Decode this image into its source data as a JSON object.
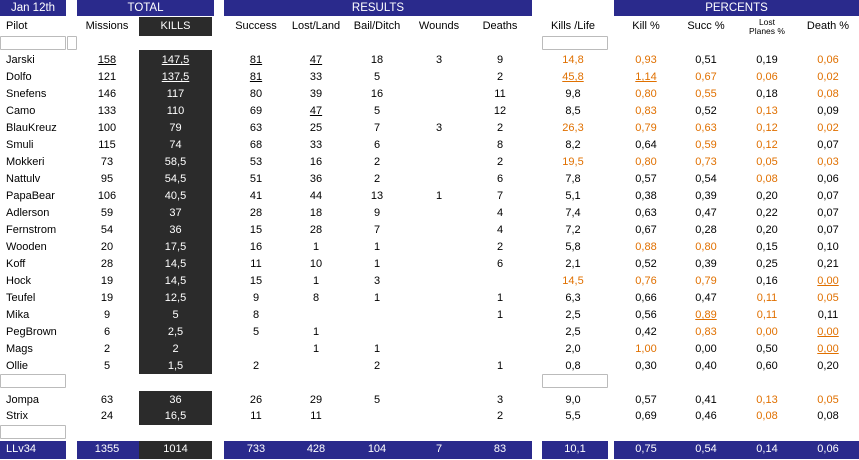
{
  "header": {
    "date": "Jan 12th",
    "total": "TOTAL",
    "results": "RESULTS",
    "percents": "PERCENTS"
  },
  "columns": {
    "pilot": "Pilot",
    "missions": "Missions",
    "kills": "KILLS",
    "success": "Success",
    "lostland": "Lost/Land",
    "bail": "Bail/Ditch",
    "wounds": "Wounds",
    "deaths": "Deaths",
    "kpl": "Kills /Life",
    "killpct": "Kill %",
    "succpct": "Succ %",
    "lostpct_line1": "Lost",
    "lostpct_line2": "Planes %",
    "deathpct": "Death %"
  },
  "rows": [
    {
      "pilot": "Jarski",
      "missions": "158",
      "kills": "147,5",
      "success": "81",
      "lostland": "47",
      "bail": "18",
      "wounds": "3",
      "deaths": "9",
      "kpl": "14,8",
      "killpct": "0,93",
      "succpct": "0,51",
      "lostpct": "0,19",
      "deathpct": "0,06"
    },
    {
      "pilot": "Dolfo",
      "missions": "121",
      "kills": "137,5",
      "success": "81",
      "lostland": "33",
      "bail": "5",
      "wounds": "",
      "deaths": "2",
      "kpl": "45,8",
      "killpct": "1,14",
      "succpct": "0,67",
      "lostpct": "0,06",
      "deathpct": "0,02"
    },
    {
      "pilot": "Snefens",
      "missions": "146",
      "kills": "117",
      "success": "80",
      "lostland": "39",
      "bail": "16",
      "wounds": "",
      "deaths": "11",
      "kpl": "9,8",
      "killpct": "0,80",
      "succpct": "0,55",
      "lostpct": "0,18",
      "deathpct": "0,08"
    },
    {
      "pilot": "Camo",
      "missions": "133",
      "kills": "110",
      "success": "69",
      "lostland": "47",
      "bail": "5",
      "wounds": "",
      "deaths": "12",
      "kpl": "8,5",
      "killpct": "0,83",
      "succpct": "0,52",
      "lostpct": "0,13",
      "deathpct": "0,09"
    },
    {
      "pilot": "BlauKreuz",
      "missions": "100",
      "kills": "79",
      "success": "63",
      "lostland": "25",
      "bail": "7",
      "wounds": "3",
      "deaths": "2",
      "kpl": "26,3",
      "killpct": "0,79",
      "succpct": "0,63",
      "lostpct": "0,12",
      "deathpct": "0,02"
    },
    {
      "pilot": "Smuli",
      "missions": "115",
      "kills": "74",
      "success": "68",
      "lostland": "33",
      "bail": "6",
      "wounds": "",
      "deaths": "8",
      "kpl": "8,2",
      "killpct": "0,64",
      "succpct": "0,59",
      "lostpct": "0,12",
      "deathpct": "0,07"
    },
    {
      "pilot": "Mokkeri",
      "missions": "73",
      "kills": "58,5",
      "success": "53",
      "lostland": "16",
      "bail": "2",
      "wounds": "",
      "deaths": "2",
      "kpl": "19,5",
      "killpct": "0,80",
      "succpct": "0,73",
      "lostpct": "0,05",
      "deathpct": "0,03"
    },
    {
      "pilot": "Nattulv",
      "missions": "95",
      "kills": "54,5",
      "success": "51",
      "lostland": "36",
      "bail": "2",
      "wounds": "",
      "deaths": "6",
      "kpl": "7,8",
      "killpct": "0,57",
      "succpct": "0,54",
      "lostpct": "0,08",
      "deathpct": "0,06"
    },
    {
      "pilot": "PapaBear",
      "missions": "106",
      "kills": "40,5",
      "success": "41",
      "lostland": "44",
      "bail": "13",
      "wounds": "1",
      "deaths": "7",
      "kpl": "5,1",
      "killpct": "0,38",
      "succpct": "0,39",
      "lostpct": "0,20",
      "deathpct": "0,07"
    },
    {
      "pilot": "Adlerson",
      "missions": "59",
      "kills": "37",
      "success": "28",
      "lostland": "18",
      "bail": "9",
      "wounds": "",
      "deaths": "4",
      "kpl": "7,4",
      "killpct": "0,63",
      "succpct": "0,47",
      "lostpct": "0,22",
      "deathpct": "0,07"
    },
    {
      "pilot": "Fernstrom",
      "missions": "54",
      "kills": "36",
      "success": "15",
      "lostland": "28",
      "bail": "7",
      "wounds": "",
      "deaths": "4",
      "kpl": "7,2",
      "killpct": "0,67",
      "succpct": "0,28",
      "lostpct": "0,20",
      "deathpct": "0,07"
    },
    {
      "pilot": "Wooden",
      "missions": "20",
      "kills": "17,5",
      "success": "16",
      "lostland": "1",
      "bail": "1",
      "wounds": "",
      "deaths": "2",
      "kpl": "5,8",
      "killpct": "0,88",
      "succpct": "0,80",
      "lostpct": "0,15",
      "deathpct": "0,10"
    },
    {
      "pilot": "Koff",
      "missions": "28",
      "kills": "14,5",
      "success": "11",
      "lostland": "10",
      "bail": "1",
      "wounds": "",
      "deaths": "6",
      "kpl": "2,1",
      "killpct": "0,52",
      "succpct": "0,39",
      "lostpct": "0,25",
      "deathpct": "0,21"
    },
    {
      "pilot": "Hock",
      "missions": "19",
      "kills": "14,5",
      "success": "15",
      "lostland": "1",
      "bail": "3",
      "wounds": "",
      "deaths": "",
      "kpl": "14,5",
      "killpct": "0,76",
      "succpct": "0,79",
      "lostpct": "0,16",
      "deathpct": "0,00"
    },
    {
      "pilot": "Teufel",
      "missions": "19",
      "kills": "12,5",
      "success": "9",
      "lostland": "8",
      "bail": "1",
      "wounds": "",
      "deaths": "1",
      "kpl": "6,3",
      "killpct": "0,66",
      "succpct": "0,47",
      "lostpct": "0,11",
      "deathpct": "0,05"
    },
    {
      "pilot": "Mika",
      "missions": "9",
      "kills": "5",
      "success": "8",
      "lostland": "",
      "bail": "",
      "wounds": "",
      "deaths": "1",
      "kpl": "2,5",
      "killpct": "0,56",
      "succpct": "0,89",
      "lostpct": "0,11",
      "deathpct": "0,11"
    },
    {
      "pilot": "PegBrown",
      "missions": "6",
      "kills": "2,5",
      "success": "5",
      "lostland": "1",
      "bail": "",
      "wounds": "",
      "deaths": "",
      "kpl": "2,5",
      "killpct": "0,42",
      "succpct": "0,83",
      "lostpct": "0,00",
      "deathpct": "0,00"
    },
    {
      "pilot": "Mags",
      "missions": "2",
      "kills": "2",
      "success": "",
      "lostland": "1",
      "bail": "1",
      "wounds": "",
      "deaths": "",
      "kpl": "2,0",
      "killpct": "1,00",
      "succpct": "0,00",
      "lostpct": "0,50",
      "deathpct": "0,00"
    },
    {
      "pilot": "Ollie",
      "missions": "5",
      "kills": "1,5",
      "success": "2",
      "lostland": "",
      "bail": "2",
      "wounds": "",
      "deaths": "1",
      "kpl": "0,8",
      "killpct": "0,30",
      "succpct": "0,40",
      "lostpct": "0,60",
      "deathpct": "0,20"
    },
    {
      "pilot": "Jompa",
      "missions": "63",
      "kills": "36",
      "success": "26",
      "lostland": "29",
      "bail": "5",
      "wounds": "",
      "deaths": "3",
      "kpl": "9,0",
      "killpct": "0,57",
      "succpct": "0,41",
      "lostpct": "0,13",
      "deathpct": "0,05"
    },
    {
      "pilot": "Strix",
      "missions": "24",
      "kills": "16,5",
      "success": "11",
      "lostland": "11",
      "bail": "",
      "wounds": "",
      "deaths": "2",
      "kpl": "5,5",
      "killpct": "0,69",
      "succpct": "0,46",
      "lostpct": "0,08",
      "deathpct": "0,08"
    }
  ],
  "totals": {
    "pilot": "LLv34",
    "missions": "1355",
    "kills": "1014",
    "success": "733",
    "lostland": "428",
    "bail": "104",
    "wounds": "7",
    "deaths": "83",
    "kpl": "10,1",
    "killpct": "0,75",
    "succpct": "0,54",
    "lostpct": "0,14",
    "deathpct": "0,06"
  },
  "colors": {
    "band": "#2a2a8c",
    "kills_bg": "#2b2b2b",
    "highlight": "#e07000"
  }
}
